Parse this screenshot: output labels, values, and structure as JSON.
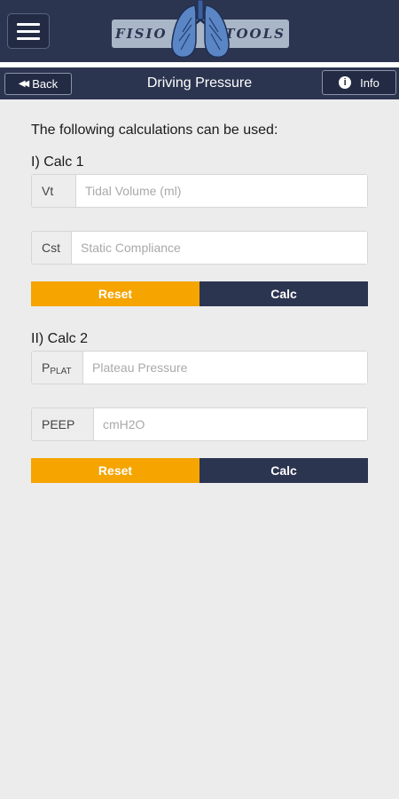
{
  "app": {
    "logo_left": "FISIO",
    "logo_right": "TOOLS"
  },
  "nav": {
    "back_label": "Back",
    "title": "Driving Pressure",
    "info_label": "Info"
  },
  "content": {
    "intro": "The following calculations can be used:",
    "calc1": {
      "title": "I) Calc 1",
      "field1_label": "Vt",
      "field1_placeholder": "Tidal Volume (ml)",
      "field1_value": "",
      "field2_label": "Cst",
      "field2_placeholder": "Static Compliance",
      "field2_value": "",
      "reset_label": "Reset",
      "calc_label": "Calc"
    },
    "calc2": {
      "title": "II) Calc 2",
      "field1_label": "P",
      "field1_label_sub": "PLAT",
      "field1_placeholder": "Plateau Pressure",
      "field1_value": "",
      "field2_label": "PEEP",
      "field2_placeholder": "cmH2O",
      "field2_value": "",
      "reset_label": "Reset",
      "calc_label": "Calc"
    }
  },
  "colors": {
    "header": "#2c3550",
    "reset": "#f5a400",
    "calc": "#2c3550",
    "background": "#ececec"
  },
  "icons": {
    "menu": "hamburger-icon",
    "back": "double-chevron-left-icon",
    "info": "info-circle-icon",
    "logo": "lungs-icon"
  }
}
